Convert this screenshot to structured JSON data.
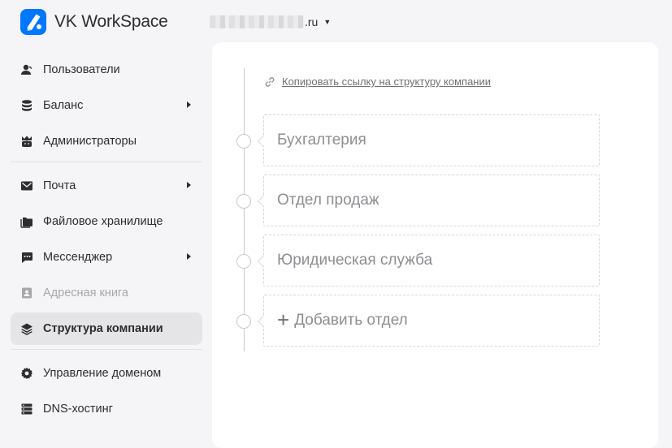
{
  "header": {
    "app_name": "VK WorkSpace",
    "domain_suffix": ".ru"
  },
  "sidebar": {
    "groups": [
      [
        {
          "label": "Пользователи",
          "icon": "user-icon",
          "has_submenu": false
        },
        {
          "label": "Баланс",
          "icon": "database-icon",
          "has_submenu": true
        },
        {
          "label": "Администраторы",
          "icon": "admin-crown-icon",
          "has_submenu": false
        }
      ],
      [
        {
          "label": "Почта",
          "icon": "mail-icon",
          "has_submenu": true
        },
        {
          "label": "Файловое хранилище",
          "icon": "folder-icon",
          "has_submenu": false
        },
        {
          "label": "Мессенджер",
          "icon": "chat-icon",
          "has_submenu": true
        },
        {
          "label": "Адресная книга",
          "icon": "address-book-icon",
          "has_submenu": false,
          "disabled": true
        },
        {
          "label": "Структура компании",
          "icon": "layers-icon",
          "has_submenu": false,
          "active": true
        }
      ],
      [
        {
          "label": "Управление доменом",
          "icon": "gear-icon",
          "has_submenu": false
        },
        {
          "label": "DNS-хостинг",
          "icon": "server-icon",
          "has_submenu": false
        }
      ]
    ]
  },
  "main": {
    "copy_link_label": "Копировать ссылку на структуру компании",
    "departments": [
      "Бухгалтерия",
      "Отдел продаж",
      "Юридическая служба"
    ],
    "add_department_label": "Добавить отдел"
  },
  "colors": {
    "accent": "#0077ff",
    "background": "#f5f5f7",
    "active_item": "#e5e5e8"
  }
}
